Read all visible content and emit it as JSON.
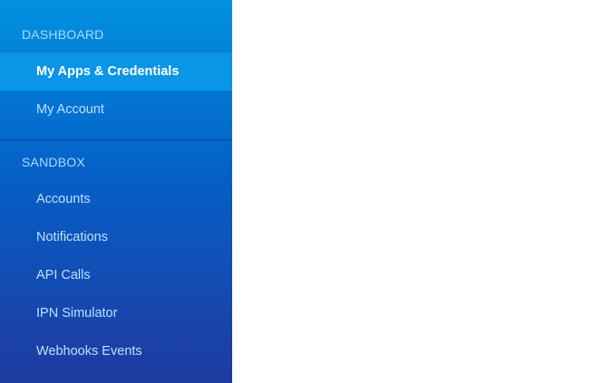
{
  "sidebar": {
    "dashboard_heading": "DASHBOARD",
    "dashboard_items": [
      {
        "label": "My Apps & Credentials",
        "active": true
      },
      {
        "label": "My Account",
        "active": false
      }
    ],
    "sandbox_heading": "SANDBOX",
    "sandbox_items": [
      {
        "label": "Accounts"
      },
      {
        "label": "Notifications"
      },
      {
        "label": "API Calls"
      },
      {
        "label": "IPN Simulator"
      },
      {
        "label": "Webhooks Events"
      }
    ]
  },
  "colors": {
    "sidebar_top": "#0191e0",
    "sidebar_bottom": "#1f3aa0",
    "active_item": "#0a95e6",
    "heading_text": "#a9dcff",
    "item_text": "#b9e0ff"
  }
}
